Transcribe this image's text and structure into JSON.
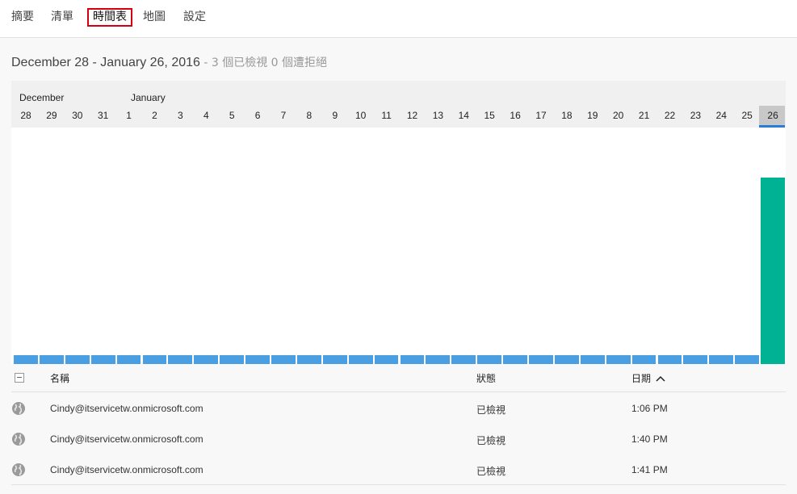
{
  "nav": {
    "tabs": [
      {
        "label": "摘要",
        "active": false
      },
      {
        "label": "清單",
        "active": false
      },
      {
        "label": "時間表",
        "active": true
      },
      {
        "label": "地圖",
        "active": false
      },
      {
        "label": "設定",
        "active": false
      }
    ]
  },
  "heading": {
    "range": "December 28 - January 26, 2016",
    "summary": " - 3 個已檢視  0 個遭拒絕"
  },
  "timeline": {
    "months": [
      "December",
      "January"
    ],
    "days": [
      "28",
      "29",
      "30",
      "31",
      "1",
      "2",
      "3",
      "4",
      "5",
      "6",
      "7",
      "8",
      "9",
      "10",
      "11",
      "12",
      "13",
      "14",
      "15",
      "16",
      "17",
      "18",
      "19",
      "20",
      "21",
      "22",
      "23",
      "24",
      "25",
      "26"
    ],
    "selected_day": "26",
    "viewed_counts": [
      0,
      0,
      0,
      0,
      0,
      0,
      0,
      0,
      0,
      0,
      0,
      0,
      0,
      0,
      0,
      0,
      0,
      0,
      0,
      0,
      0,
      0,
      0,
      0,
      0,
      0,
      0,
      0,
      0,
      3
    ],
    "colors": {
      "empty": "#4a9ee2",
      "viewed": "#00b294",
      "selected_underline": "#2b7cd3"
    }
  },
  "table": {
    "headers": {
      "name": "名稱",
      "status": "狀態",
      "date": "日期"
    },
    "sort": "ascending",
    "rows": [
      {
        "icon": "globe-icon",
        "name": "Cindy@itservicetw.onmicrosoft.com",
        "status": "已檢視",
        "time": "1:06 PM"
      },
      {
        "icon": "globe-icon",
        "name": "Cindy@itservicetw.onmicrosoft.com",
        "status": "已檢視",
        "time": "1:40 PM"
      },
      {
        "icon": "globe-icon",
        "name": "Cindy@itservicetw.onmicrosoft.com",
        "status": "已檢視",
        "time": "1:41 PM"
      }
    ]
  }
}
